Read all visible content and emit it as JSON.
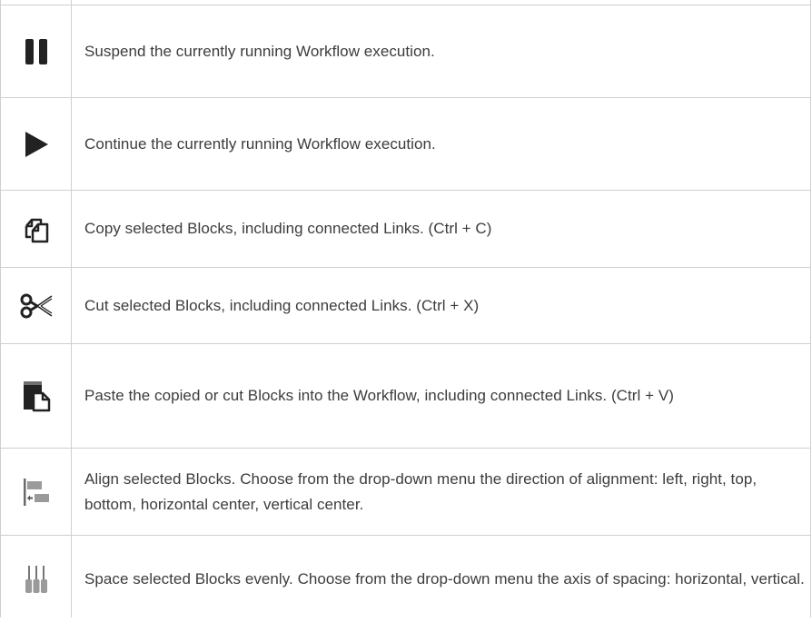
{
  "rows": [
    {
      "icon": "pause-icon",
      "text": "Suspend the currently running Workflow execution."
    },
    {
      "icon": "play-icon",
      "text": "Continue the currently running Workflow execution."
    },
    {
      "icon": "copy-icon",
      "text": "Copy selected Blocks, including connected Links. (Ctrl + C)"
    },
    {
      "icon": "cut-icon",
      "text": "Cut selected Blocks, including connected Links. (Ctrl + X)"
    },
    {
      "icon": "paste-icon",
      "text": "Paste the copied or cut Blocks into the Workflow, including connected Links. (Ctrl + V)"
    },
    {
      "icon": "align-icon",
      "text": "Align selected Blocks. Choose from the drop-down menu the direction of alignment: left, right, top, bottom, horizontal center, vertical center."
    },
    {
      "icon": "distribute-icon",
      "text": "Space selected Blocks evenly. Choose from the drop-down menu the axis of spacing: horizontal, vertical."
    }
  ],
  "colors": {
    "icon": "#222222",
    "icon_muted": "#8a8a8a",
    "border": "#cfcfcf",
    "text": "#3c3c3c"
  }
}
